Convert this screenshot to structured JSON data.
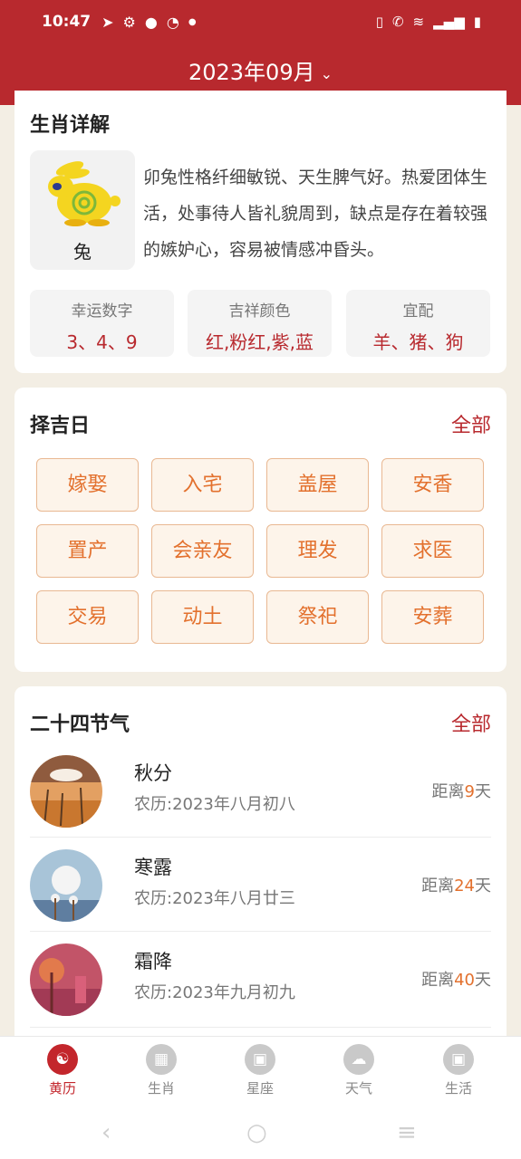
{
  "status_bar": {
    "time": "10:47",
    "left_icons": [
      "telegram-icon",
      "gear-icon",
      "location-icon",
      "speed-icon",
      "dot-icon"
    ],
    "right_icons": [
      "vibrate-icon",
      "wifi-call-icon",
      "wifi-icon",
      "signal-icon",
      "battery-icon"
    ]
  },
  "header": {
    "title": "2023年09月"
  },
  "zodiac": {
    "section_title": "生肖详解",
    "name": "兔",
    "description": "卯兔性格纤细敏锐、天生脾气好。热爱团体生活，处事待人皆礼貌周到，缺点是存在着较强的嫉妒心，容易被情感冲昏头。",
    "info": [
      {
        "label": "幸运数字",
        "value": "3、4、9"
      },
      {
        "label": "吉祥颜色",
        "value": "红,粉红,紫,蓝"
      },
      {
        "label": "宜配",
        "value": "羊、猪、狗"
      }
    ]
  },
  "auspicious": {
    "section_title": "择吉日",
    "more_label": "全部",
    "tags": [
      "嫁娶",
      "入宅",
      "盖屋",
      "安香",
      "置产",
      "会亲友",
      "理发",
      "求医",
      "交易",
      "动土",
      "祭祀",
      "安葬"
    ]
  },
  "solar_terms": {
    "section_title": "二十四节气",
    "more_label": "全部",
    "distance_prefix": "距离",
    "distance_suffix": "天",
    "items": [
      {
        "name": "秋分",
        "lunar": "农历:2023年八月初八",
        "days": "9"
      },
      {
        "name": "寒露",
        "lunar": "农历:2023年八月廿三",
        "days": "24"
      },
      {
        "name": "霜降",
        "lunar": "农历:2023年九月初九",
        "days": "40"
      }
    ]
  },
  "bottom_nav": [
    {
      "label": "黄历",
      "active": true
    },
    {
      "label": "生肖",
      "active": false
    },
    {
      "label": "星座",
      "active": false
    },
    {
      "label": "天气",
      "active": false
    },
    {
      "label": "生活",
      "active": false
    }
  ],
  "colors": {
    "brand_red": "#b8292e",
    "accent_orange": "#e3712e",
    "background": "#f3eee4"
  }
}
